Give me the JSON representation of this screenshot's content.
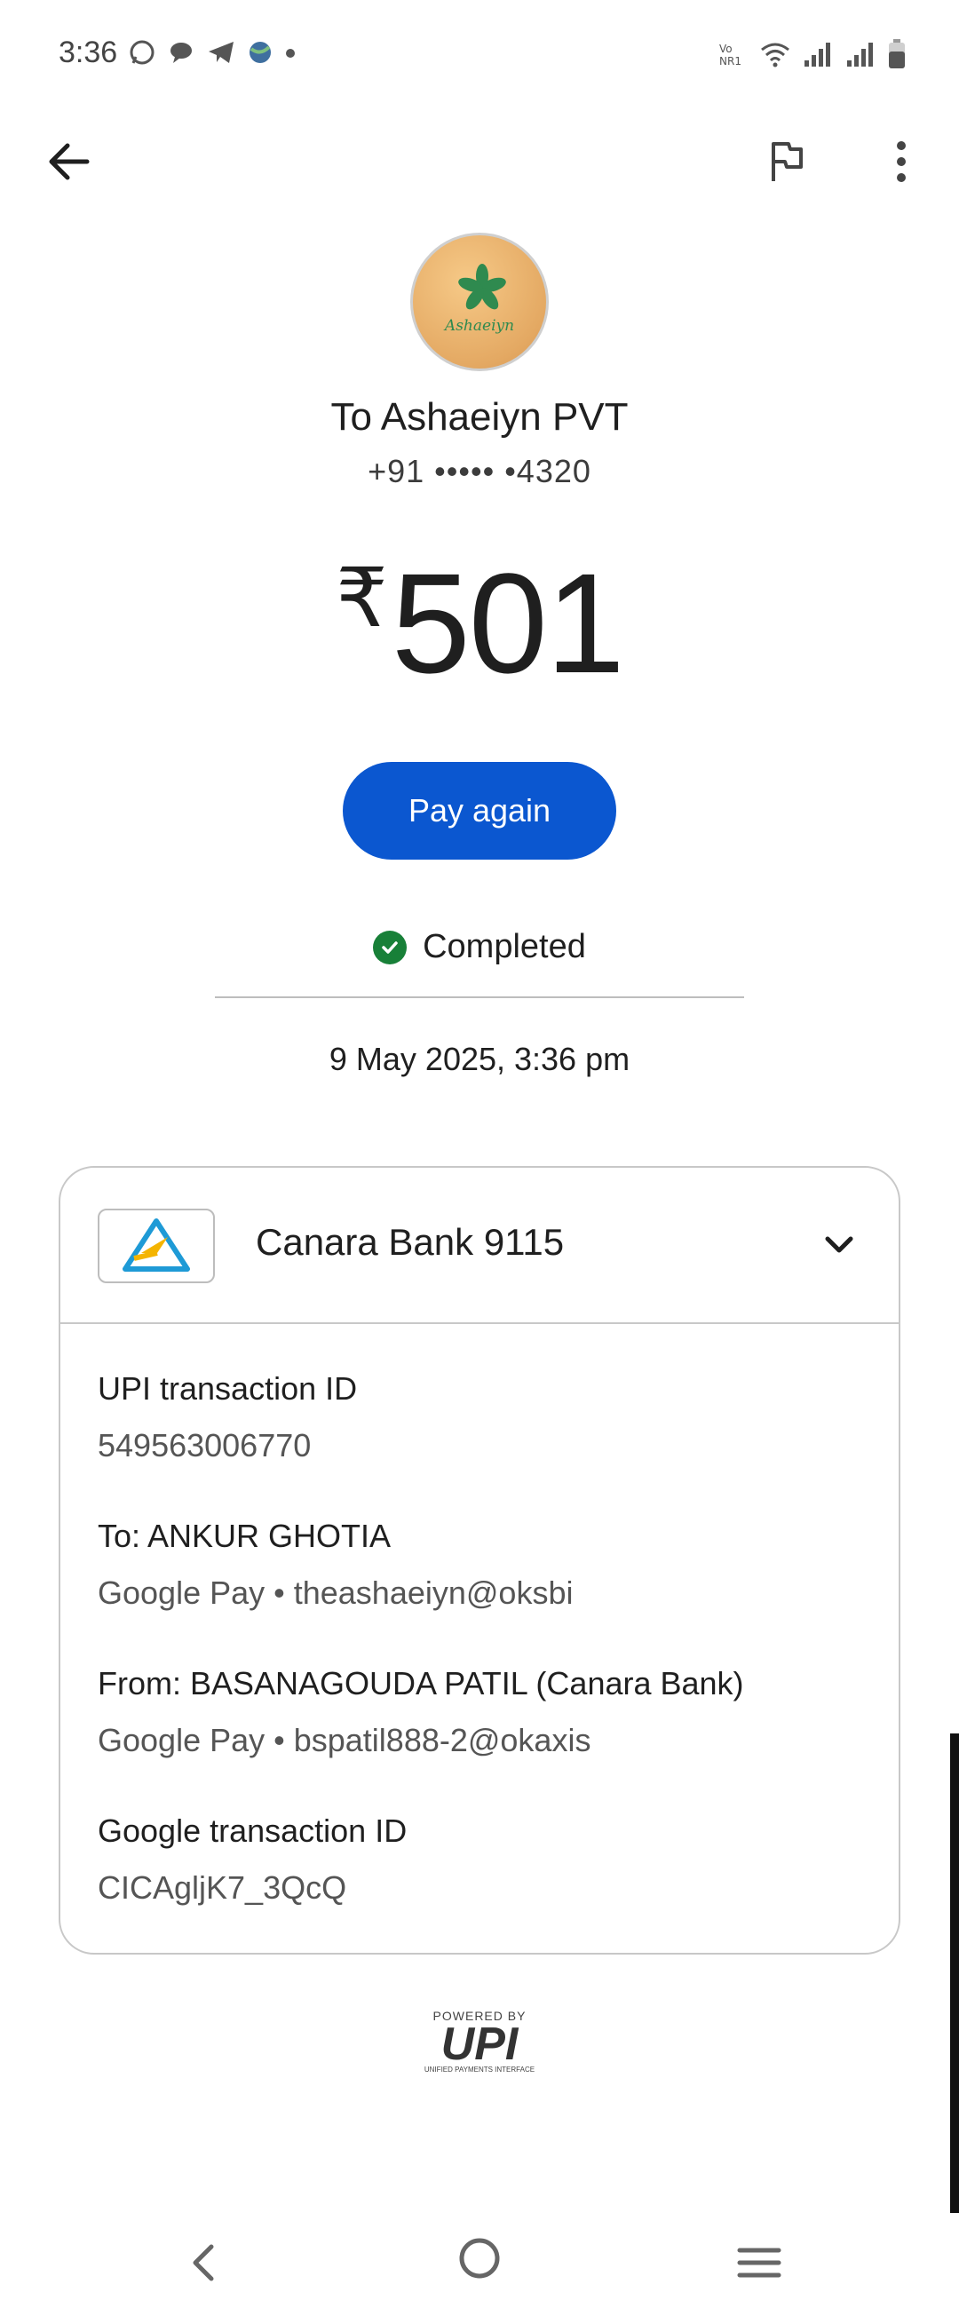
{
  "status_bar": {
    "time": "3:36"
  },
  "recipient": {
    "avatar_text": "Ashaeiyn",
    "name": "To Ashaeiyn PVT",
    "phone": "+91 ••••• •4320"
  },
  "amount": {
    "currency": "₹",
    "value": "501"
  },
  "actions": {
    "pay_again_label": "Pay again"
  },
  "status": {
    "text": "Completed",
    "date_time": "9 May 2025, 3:36 pm"
  },
  "card": {
    "bank_name": "Canara Bank 9115",
    "details": [
      {
        "label": "UPI transaction ID",
        "value": "549563006770"
      },
      {
        "label": "To: ANKUR GHOTIA",
        "value": "Google Pay • theashaeiyn@oksbi"
      },
      {
        "label": "From: BASANAGOUDA  PATIL (Canara Bank)",
        "value": "Google Pay • bspatil888-2@okaxis"
      },
      {
        "label": "Google transaction ID",
        "value": "CICAgljK7_3QcQ"
      }
    ]
  },
  "footer": {
    "powered_by": "POWERED BY",
    "upi": "UPI",
    "upi_sub": "UNIFIED PAYMENTS INTERFACE"
  },
  "colors": {
    "accent": "#0b57d0",
    "success": "#188038"
  }
}
